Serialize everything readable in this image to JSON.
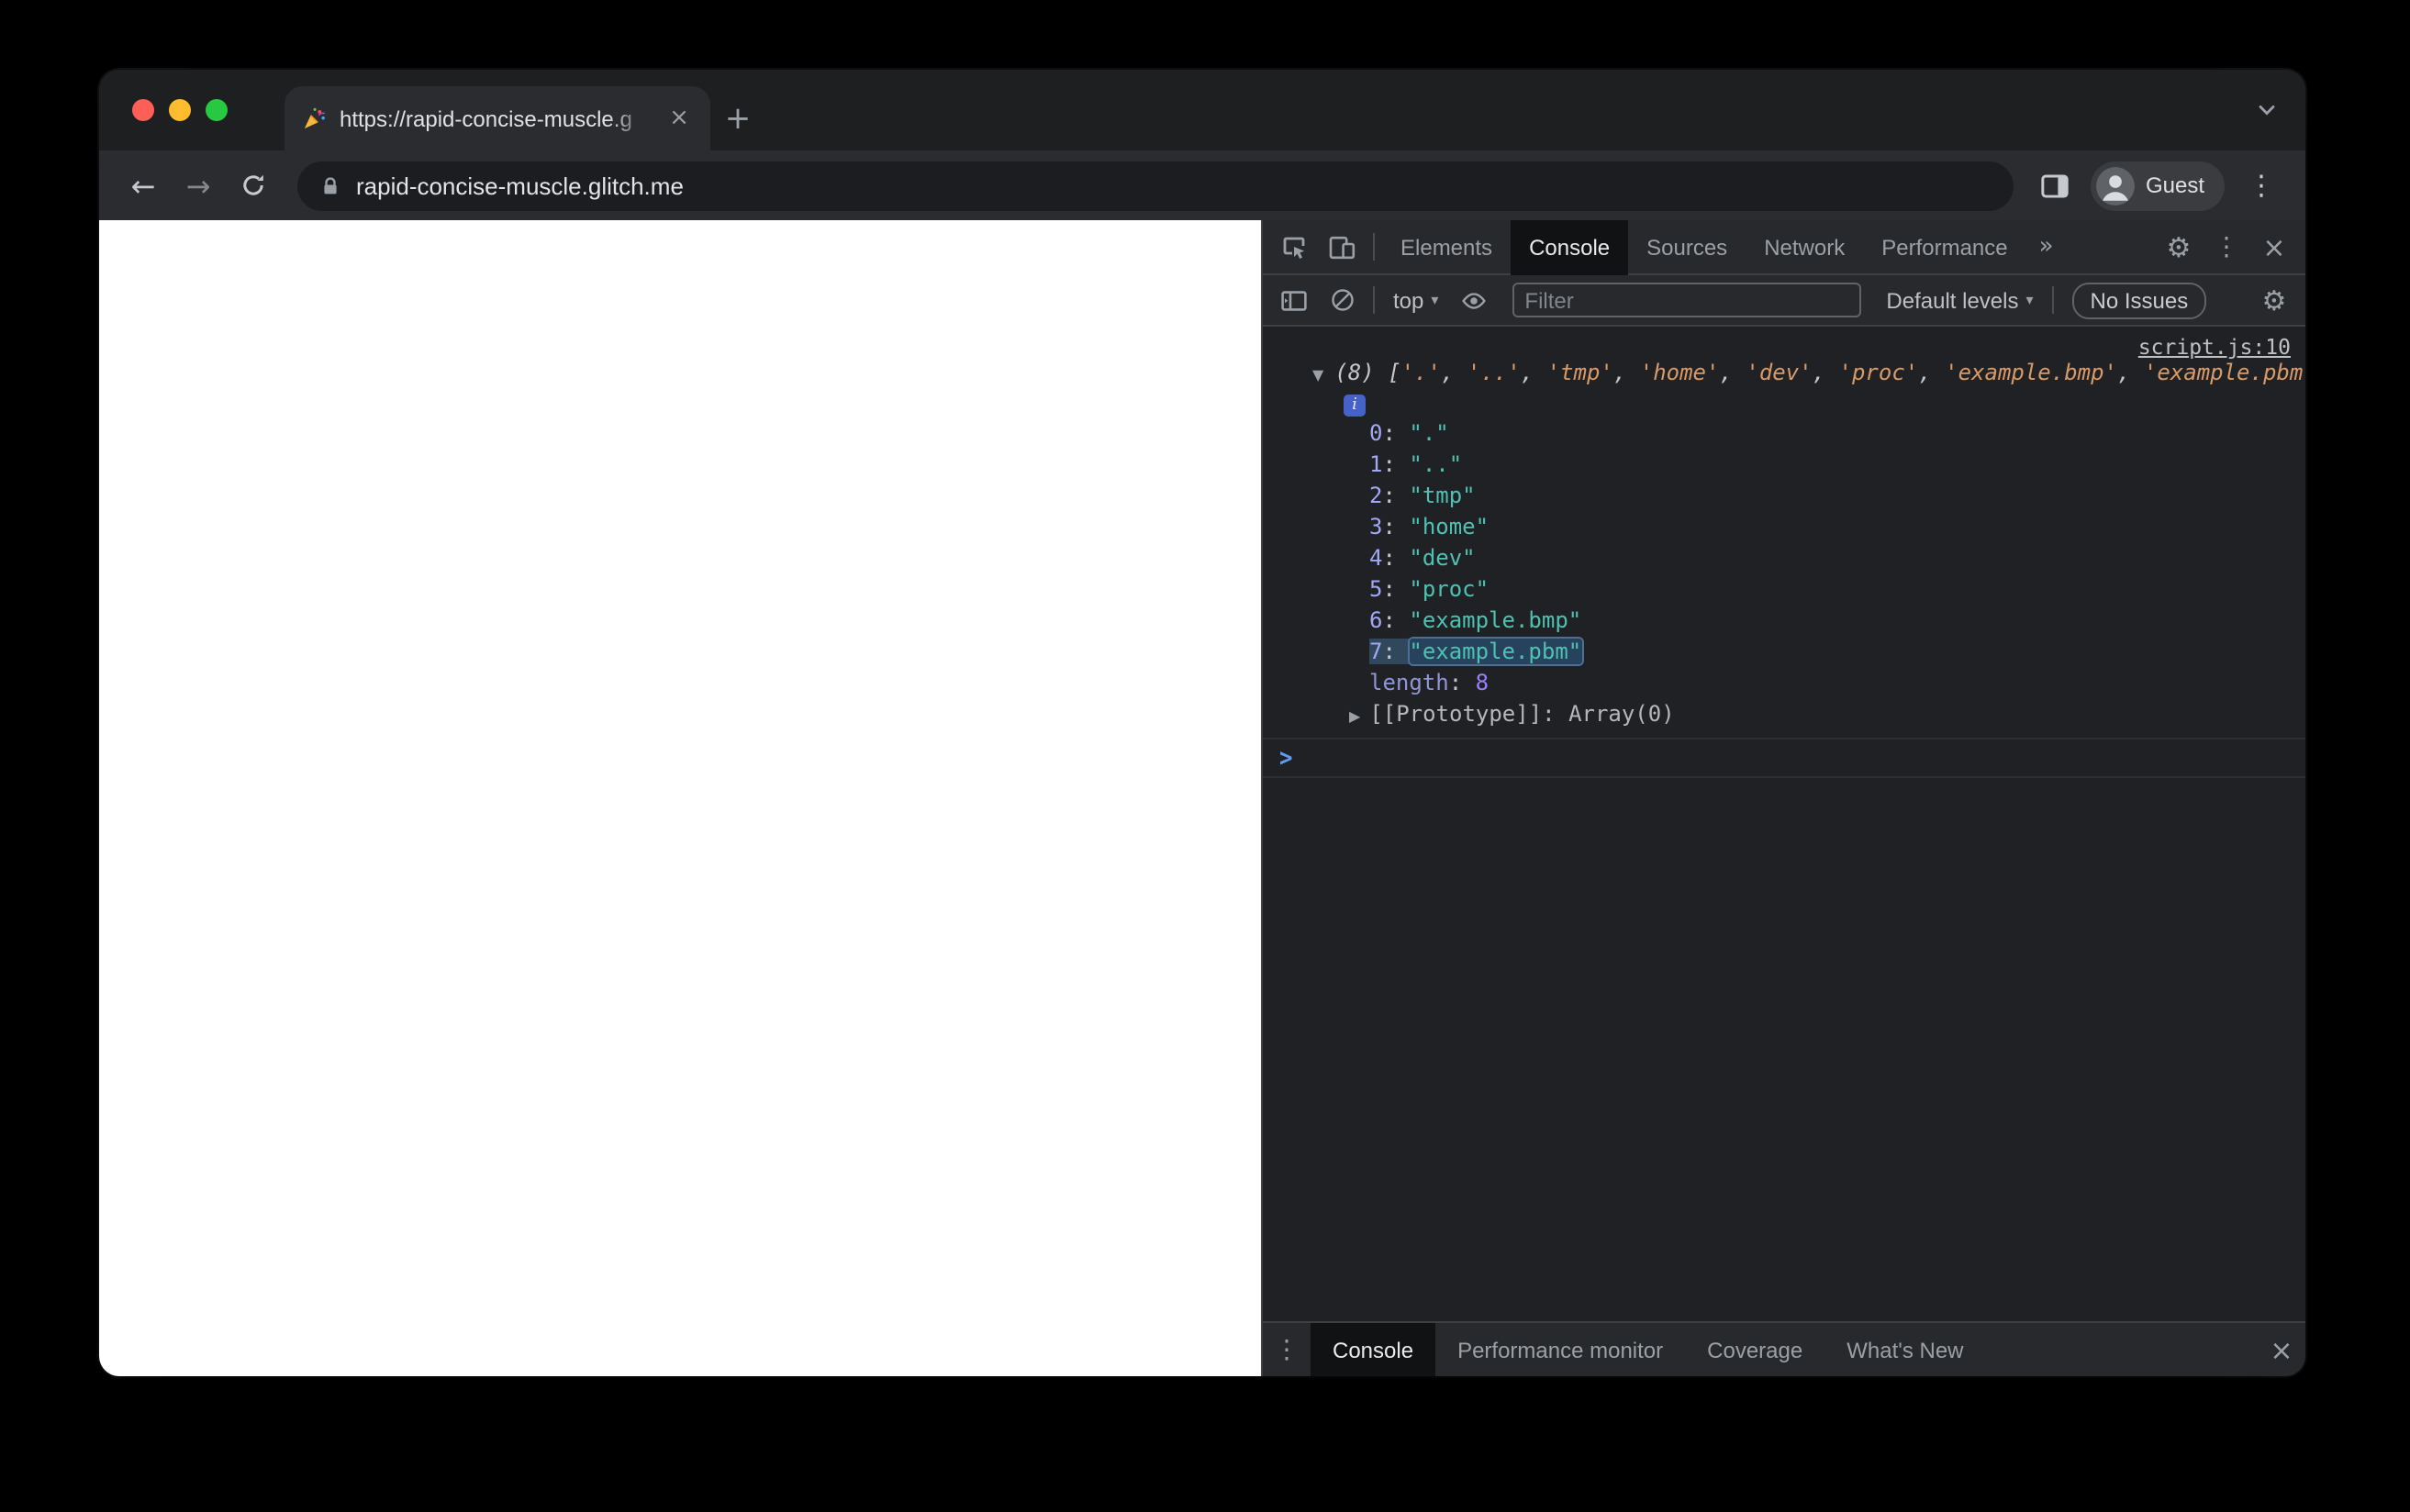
{
  "browser": {
    "tab": {
      "favicon_icon": "party-popper",
      "title": "https://rapid-concise-muscle.g"
    },
    "address": {
      "url": "rapid-concise-muscle.glitch.me"
    },
    "profile": {
      "name": "Guest"
    }
  },
  "icons": {
    "close": "×",
    "kebab": "⋮",
    "gear": "⚙",
    "dropdown": "▾",
    "expanded": "▼",
    "collapsed": "▶",
    "prompt": ">",
    "info": "i",
    "back": "←",
    "forward": "→",
    "plus": "+",
    "more": "»"
  },
  "colors": {
    "accent_blue": "#5c9cf5",
    "string_preview": "#d79a68",
    "string_value": "#4fc1b2",
    "index_key": "#a2a8f5",
    "number": "#9980ff",
    "devtools_bg": "#202124"
  },
  "devtools": {
    "main_tabs": [
      {
        "label": "Elements",
        "active": false
      },
      {
        "label": "Console",
        "active": true
      },
      {
        "label": "Sources",
        "active": false
      },
      {
        "label": "Network",
        "active": false
      },
      {
        "label": "Performance",
        "active": false
      }
    ],
    "console_toolbar": {
      "context_selector": "top",
      "filter_placeholder": "Filter",
      "levels_label": "Default levels",
      "issues_label": "No Issues"
    },
    "console": {
      "source_link": "script.js:10",
      "array_preview": {
        "count": "(8)",
        "items": [
          ".",
          "..",
          "tmp",
          "home",
          "dev",
          "proc",
          "example.bmp",
          "example.pbm"
        ]
      },
      "selected_index": 7,
      "length_label": "length",
      "length_value": "8",
      "prototype_label": "[[Prototype]]",
      "prototype_separator": ": ",
      "prototype_value": "Array(0)"
    },
    "drawer_tabs": [
      {
        "label": "Console",
        "active": true
      },
      {
        "label": "Performance monitor",
        "active": false
      },
      {
        "label": "Coverage",
        "active": false
      },
      {
        "label": "What's New",
        "active": false
      }
    ]
  }
}
